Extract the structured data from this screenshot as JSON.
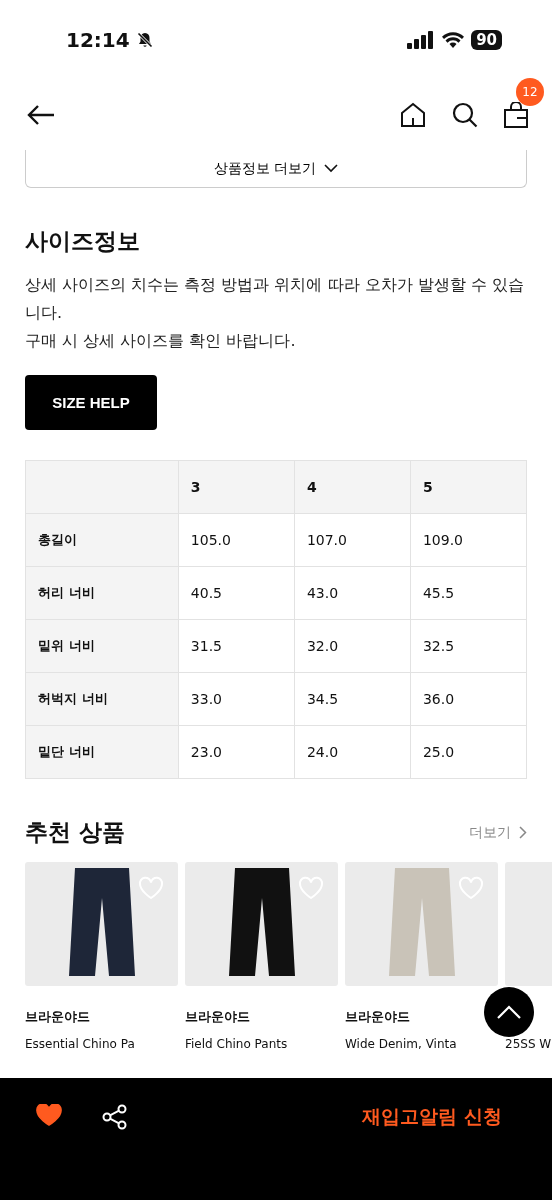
{
  "status_bar": {
    "time": "12:14",
    "battery": "90"
  },
  "nav": {
    "cart_count": "12"
  },
  "more_button": {
    "label": "상품정보 더보기"
  },
  "size_info": {
    "title": "사이즈정보",
    "description": [
      "상세 사이즈의 치수는 측정 방법과 위치에 따라 오차가 발생할 수 있습니다.",
      "구매 시 상세 사이즈를 확인 바랍니다."
    ],
    "help_button": "SIZE HELP"
  },
  "size_table": {
    "columns": [
      "3",
      "4",
      "5"
    ],
    "rows": [
      {
        "label": "총길이",
        "values": [
          "105.0",
          "107.0",
          "109.0"
        ]
      },
      {
        "label": "허리 너비",
        "values": [
          "40.5",
          "43.0",
          "45.5"
        ]
      },
      {
        "label": "밑위 너비",
        "values": [
          "31.5",
          "32.0",
          "32.5"
        ]
      },
      {
        "label": "허벅지 너비",
        "values": [
          "33.0",
          "34.5",
          "36.0"
        ]
      },
      {
        "label": "밑단 너비",
        "values": [
          "23.0",
          "24.0",
          "25.0"
        ]
      }
    ]
  },
  "recommended": {
    "title": "추천 상품",
    "more": "더보기",
    "products": [
      {
        "brand": "브라운야드",
        "name": "Essential Chino Pa",
        "liked": false,
        "color": "#1e2638"
      },
      {
        "brand": "브라운야드",
        "name": "Field Chino Pants",
        "liked": false,
        "color": "#111111"
      },
      {
        "brand": "브라운야드",
        "name": "Wide Denim, Vinta",
        "liked": false,
        "color": "#c9c3b8"
      },
      {
        "name": "25SS W"
      }
    ]
  },
  "bottom_bar": {
    "liked": true,
    "action": "재입고알림 신청"
  }
}
